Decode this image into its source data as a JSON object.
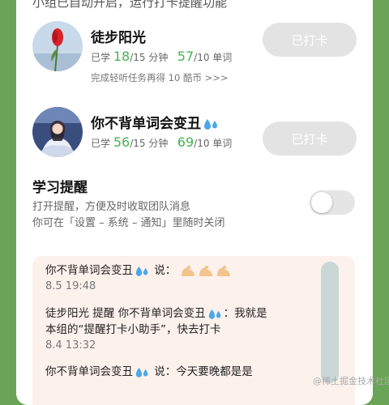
{
  "header": {
    "cut_text": "小组已自动开启，运行打卡提醒功能"
  },
  "members": [
    {
      "name": "徒步阳光",
      "learned_label": "已学",
      "minutes_done": "18",
      "minutes_goal": "/15 分钟",
      "words_done": "57",
      "words_goal": "/10 单词",
      "hint": "完成轻听任务再得 10 酷币 >>>",
      "button": "已打卡"
    },
    {
      "name": "你不背单词会变丑",
      "learned_label": "已学",
      "minutes_done": "56",
      "minutes_goal": "/15 分钟",
      "words_done": "69",
      "words_goal": "/10 单词",
      "button": "已打卡"
    }
  ],
  "reminder": {
    "title": "学习提醒",
    "line1": "打开提醒，方便及时收取团队消息",
    "line2": "你可在「设置 – 系统 – 通知」里随时关闭",
    "enabled": false
  },
  "messages": [
    {
      "text_pre": "你不背单词会变丑",
      "text_post": " 说：",
      "time": "8.5 19:48"
    },
    {
      "line1_pre": "徒步阳光 提醒 你不背单词会变丑",
      "line1_post": "：我就是",
      "line2": "本组的“提醒打卡小助手”，快去打卡",
      "time": "8.4 13:32"
    },
    {
      "text_pre": "你不背单词会变丑",
      "text_post": " 说：今天要晚都是是"
    }
  ],
  "watermark": "@稀土掘金技术社区",
  "colors": {
    "background": "#6aa456",
    "accent_green": "#46b355",
    "button_disabled": "#e3e3e3",
    "message_bg": "#fdf1ec"
  }
}
